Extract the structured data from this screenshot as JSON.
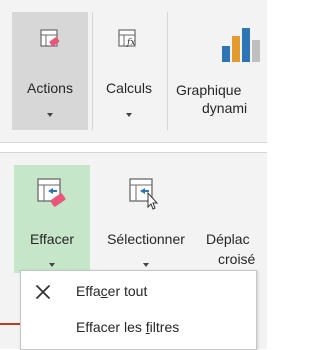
{
  "ribbon_top": {
    "actions": {
      "label": "Actions"
    },
    "calculs": {
      "label": "Calculs"
    },
    "graphique": {
      "label_line1": "Graphique",
      "label_line2": "dynami"
    }
  },
  "ribbon_second": {
    "effacer": {
      "label": "Effacer"
    },
    "selectionner": {
      "label": "Sélectionner"
    },
    "deplacer": {
      "label_line1": "Déplac",
      "label_line2": "croisé"
    }
  },
  "dropdown": {
    "items": [
      {
        "pre": "Effa",
        "accel": "c",
        "post": "er tout"
      },
      {
        "pre": "Effacer les ",
        "accel": "f",
        "post": "iltres"
      }
    ]
  },
  "colors": {
    "ribbon_bg": "#f3f3f3",
    "active_button": "#d7d7d7",
    "effacer_highlight": "#c6e6c9",
    "accent_pink": "#e8577a",
    "accent_blue": "#2e75b6",
    "accent_orange": "#e39a2e"
  }
}
